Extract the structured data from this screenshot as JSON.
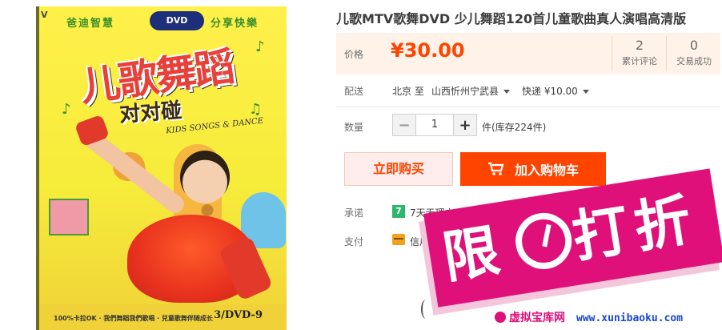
{
  "product_image": {
    "top_left_text": "爸迪智慧",
    "top_right_text": "分享快樂",
    "badge_text": "DVD",
    "title_text": "儿歌舞蹈",
    "subtitle_text": "对对碰",
    "english_text": "KIDS SONGS & DANCE",
    "bottom_text": "100%卡拉OK · 我們舞蹈我們歌唱 · 兒童歌舞伴随成长",
    "disc_text": "3/DVD-9"
  },
  "product": {
    "title": "儿歌MTV歌舞DVD 少儿舞蹈120首儿童歌曲真人演唱高清版"
  },
  "price": {
    "label": "价格",
    "value": "¥30.00",
    "reviews_count": "2",
    "reviews_label": "累计评论",
    "sales_count": "0",
    "sales_label": "交易成功",
    "accent_color": "#ff4400"
  },
  "shipping": {
    "label": "配送",
    "from": "北京 至",
    "to": "山西忻州宁武县",
    "method": "快递 ¥10.00"
  },
  "quantity": {
    "label": "数量",
    "minus": "−",
    "value": "1",
    "plus": "+",
    "stock": "件(库存224件)"
  },
  "actions": {
    "buy_now": "立即购买",
    "add_to_cart": "加入购物车",
    "cart_icon": "shopping-cart-icon"
  },
  "promise": {
    "label": "承诺",
    "icon_text": "7",
    "text": "7天无理由"
  },
  "payment": {
    "label": "支付",
    "text": "信用"
  },
  "watermark": {
    "stamp_left": "限",
    "stamp_right": "打折",
    "site_name": "虚拟宝库网",
    "site_url": "www.xunibaoku.com",
    "color": "#e0107a"
  }
}
